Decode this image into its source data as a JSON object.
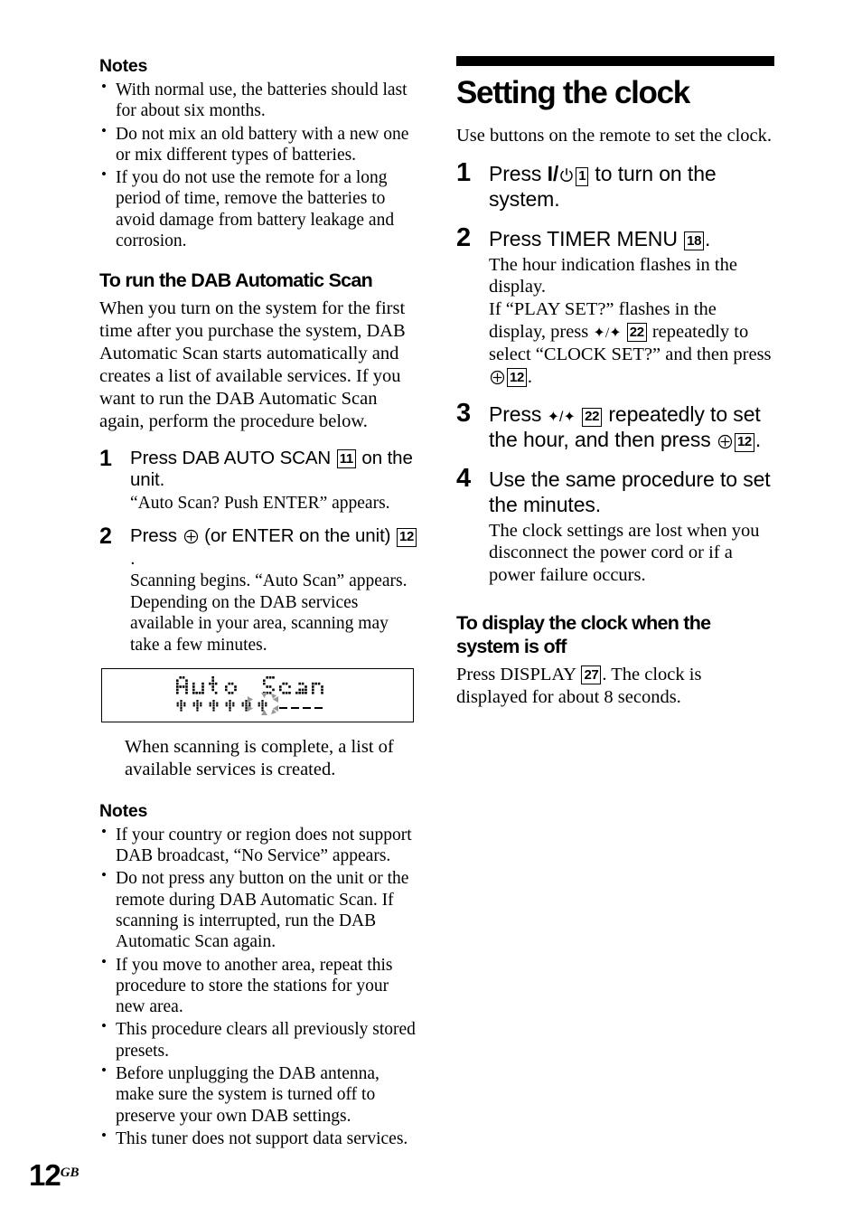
{
  "page": {
    "number": "12",
    "region_code": "GB"
  },
  "left_column": {
    "notes_top": {
      "heading": "Notes",
      "items": [
        "With normal use, the batteries should last for about six months.",
        "Do not mix an old battery with a new one or mix different types of batteries.",
        "If you do not use the remote for a long period of time, remove the batteries to avoid damage from battery leakage and corrosion."
      ]
    },
    "section": {
      "heading": "To run the DAB Automatic Scan",
      "intro": "When you turn on the system for the first time after you purchase the system, DAB Automatic Scan starts automatically and creates a list of available services. If you want to run the DAB Automatic Scan again, perform the procedure below.",
      "steps": [
        {
          "number": "1",
          "lead_before": "Press DAB AUTO SCAN ",
          "ref": "11",
          "lead_after": " on the unit.",
          "sub": "“Auto Scan? Push ENTER” appears."
        },
        {
          "number": "2",
          "lead_before": "Press ",
          "enter_icon": "enter-circle-icon",
          "lead_mid": " (or ENTER on the unit) ",
          "ref": "12",
          "lead_after": ".",
          "sub": "Scanning begins. “Auto Scan” appears. Depending on the DAB services available in your area, scanning may take a few minutes."
        }
      ],
      "display_illustration": {
        "line1": "Auto Scan",
        "line2_markers": "✻ ✻ ✻ ✻ ✻ ✻",
        "icon": "lcd-display-panel"
      },
      "after_illustration": "When scanning is complete, a list of available services is created."
    },
    "notes_bottom": {
      "heading": "Notes",
      "items": [
        "If your country or region does not support DAB broadcast, “No Service” appears.",
        "Do not press any button on the unit or the remote during DAB Automatic Scan. If scanning is interrupted, run the DAB Automatic Scan again.",
        "If you move to another area, repeat this procedure to store the stations for your new area.",
        "This procedure clears all previously stored presets.",
        "Before unplugging the DAB antenna, make sure the system is turned off to preserve your own DAB settings.",
        "This tuner does not support data services."
      ]
    }
  },
  "right_column": {
    "title": "Setting the clock",
    "intro": "Use buttons on the remote to set the clock.",
    "steps": [
      {
        "number": "1",
        "lead_before": "Press ",
        "power_symbol": "I/",
        "power_icon": "power-standby-icon",
        "ref": "1",
        "lead_after": " to turn on the system."
      },
      {
        "number": "2",
        "lead_before": "Press TIMER MENU ",
        "ref": "18",
        "lead_after": ".",
        "sub_line1": "The hour indication flashes in the display.",
        "sub_line2_a": "If “PLAY SET?” flashes in the display, press ",
        "sub_arrows": "✦/✦",
        "sub_ref1": "22",
        "sub_line2_b": " repeatedly to select “CLOCK SET?” and then press ",
        "sub_enter_icon": "enter-circle-icon",
        "sub_ref2": "12",
        "sub_line2_c": "."
      },
      {
        "number": "3",
        "lead_before": "Press ",
        "arrows": "✦/✦",
        "ref1": "22",
        "lead_mid": " repeatedly to set the hour, and then press ",
        "enter_icon": "enter-circle-icon",
        "ref2": "12",
        "lead_after": "."
      },
      {
        "number": "4",
        "lead": "Use the same procedure to set the minutes.",
        "sub": "The clock settings are lost when you disconnect the power cord or if a power failure occurs."
      }
    ],
    "subsection": {
      "heading": "To display the clock when the system is off",
      "body_before": "Press DISPLAY ",
      "ref": "27",
      "body_after": ". The clock is displayed for about 8 seconds."
    }
  }
}
